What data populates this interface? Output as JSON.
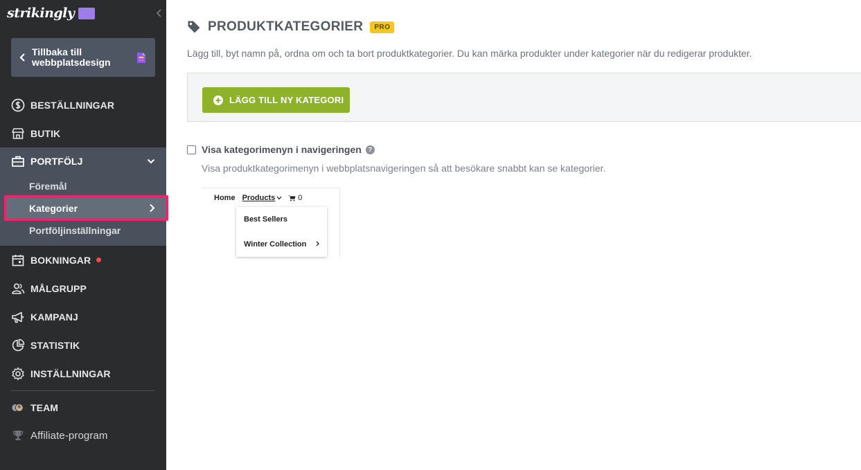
{
  "sidebar": {
    "logo": "strikingly",
    "back_label": "Tillbaka till webbplatsdesign",
    "items": {
      "orders": "BESTÄLLNINGAR",
      "store": "BUTIK",
      "portfolio": "PORTFÖLJ",
      "bookings": "BOKNINGAR",
      "audience": "MÅLGRUPP",
      "campaign": "KAMPANJ",
      "statistics": "STATISTIK",
      "settings": "INSTÄLLNINGAR",
      "team": "TEAM",
      "affiliate": "Affiliate-program"
    },
    "portfolio_sub": {
      "items": "Föremål",
      "categories": "Kategorier",
      "settings": "Portföljinställningar"
    }
  },
  "main": {
    "title": "PRODUKTKATEGORIER",
    "badge": "PRO",
    "description": "Lägg till, byt namn på, ordna om och ta bort produktkategorier. Du kan märka produkter under kategorier när du redigerar produkter.",
    "add_button": "LÄGG TILL NY KATEGORI",
    "checkbox_label": "Visa kategorimenyn i navigeringen",
    "checkbox_checked": false,
    "checkbox_description": "Visa produktkategorimenyn i webbplatsnavigeringen så att besökare snabbt kan se kategorier.",
    "preview": {
      "home": "Home",
      "products": "Products",
      "cart_count": "0",
      "dropdown": [
        "Best Sellers",
        "Winter Collection"
      ]
    }
  },
  "colors": {
    "sidebar_bg": "#2b2c2e",
    "portfolio_group_bg": "#4a515c",
    "highlight": "#f0246d",
    "add_button": "#8eb229",
    "pro_badge": "#f3c623"
  }
}
